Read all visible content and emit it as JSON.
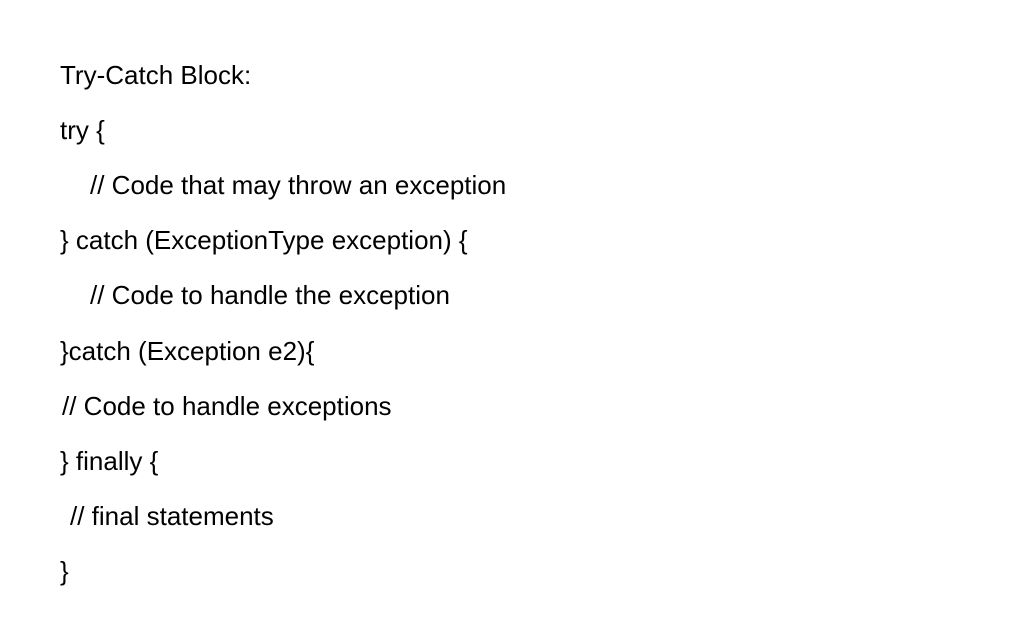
{
  "code": {
    "line1": "Try-Catch Block:",
    "line2": "try {",
    "line3": "// Code that may throw an exception",
    "line4": "} catch (ExceptionType exception) {",
    "line5": "// Code to handle the exception",
    "line6": "}catch (Exception e2){",
    "line7": "// Code to handle exceptions",
    "line8": "} finally {",
    "line9": "// final statements",
    "line10": "}"
  }
}
